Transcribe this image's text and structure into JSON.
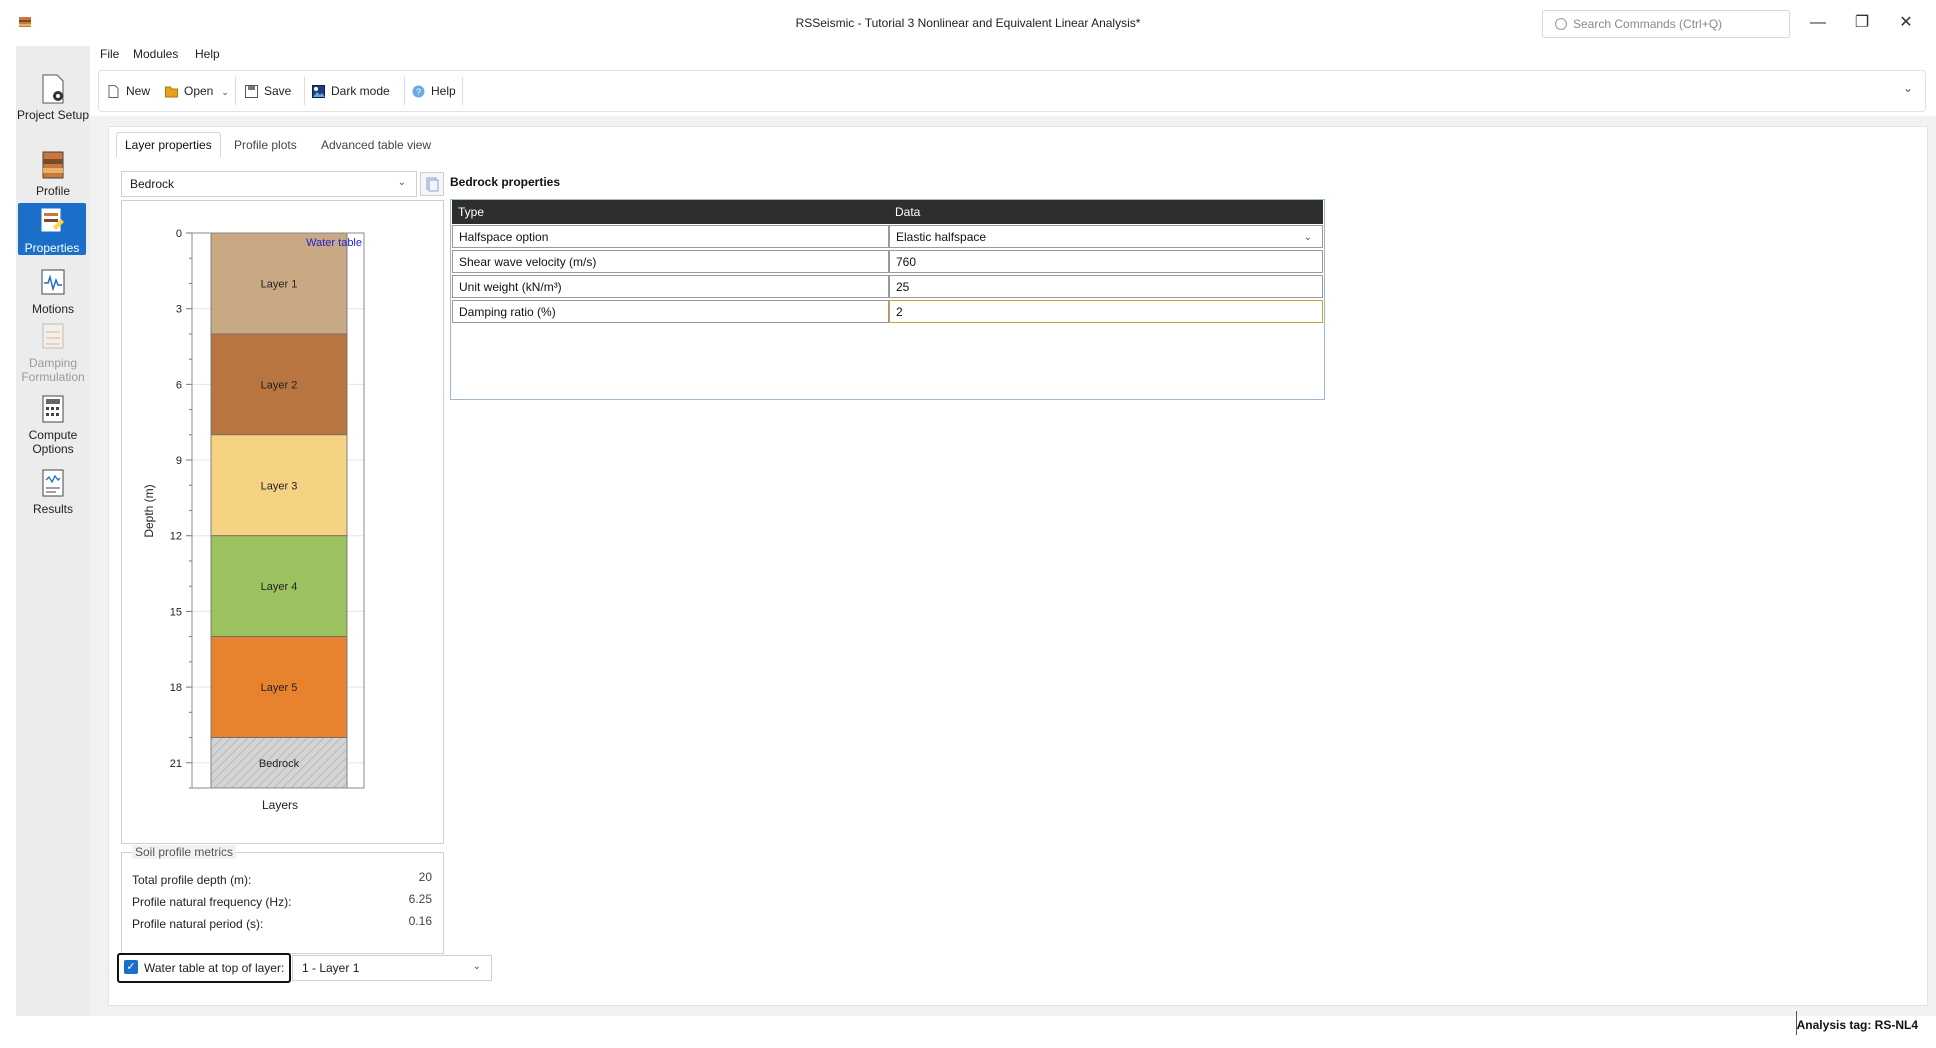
{
  "window": {
    "title": "RSSeismic - Tutorial 3 Nonlinear and Equivalent Linear Analysis*",
    "search_placeholder": "Search Commands (Ctrl+Q)",
    "minimize": "—",
    "restore": "❐",
    "close": "✕"
  },
  "menu": {
    "file": "File",
    "modules": "Modules",
    "help": "Help"
  },
  "toolbar": {
    "new": "New",
    "open": "Open",
    "save": "Save",
    "dark_mode": "Dark mode",
    "help": "Help"
  },
  "sidebar": {
    "items": [
      {
        "label": "Project Setup",
        "icon": "project-setup-icon",
        "state": "normal"
      },
      {
        "label": "Profile",
        "icon": "profile-icon",
        "state": "normal"
      },
      {
        "label": "Properties",
        "icon": "properties-icon",
        "state": "active"
      },
      {
        "label": "Motions",
        "icon": "motions-icon",
        "state": "normal"
      },
      {
        "label": "Damping Formulation",
        "icon": "damping-icon",
        "state": "disabled"
      },
      {
        "label": "Compute Options",
        "icon": "compute-icon",
        "state": "normal"
      },
      {
        "label": "Results",
        "icon": "results-icon",
        "state": "normal"
      }
    ]
  },
  "tabs": [
    {
      "label": "Layer properties",
      "active": true
    },
    {
      "label": "Profile plots",
      "active": false
    },
    {
      "label": "Advanced table view",
      "active": false
    }
  ],
  "layer_select": {
    "value": "Bedrock"
  },
  "profile_plot": {
    "ylabel": "Depth (m)",
    "xlabel": "Layers",
    "water_table_label": "Water table",
    "yticks": [
      "0",
      "3",
      "6",
      "9",
      "12",
      "15",
      "18",
      "21"
    ],
    "layers": [
      {
        "name": "Layer 1",
        "top": 0,
        "bottom": 4,
        "color": "#c9a983"
      },
      {
        "name": "Layer 2",
        "top": 4,
        "bottom": 8,
        "color": "#b87540"
      },
      {
        "name": "Layer 3",
        "top": 8,
        "bottom": 12,
        "color": "#f6d283"
      },
      {
        "name": "Layer 4",
        "top": 12,
        "bottom": 16,
        "color": "#9bc25e"
      },
      {
        "name": "Layer 5",
        "top": 16,
        "bottom": 20,
        "color": "#e8822e"
      },
      {
        "name": "Bedrock",
        "top": 20,
        "bottom": 22,
        "color": "#d4d4d4"
      }
    ],
    "ylim": [
      0,
      22
    ]
  },
  "metrics": {
    "title": "Soil profile metrics",
    "rows": [
      {
        "label": "Total profile depth (m):",
        "value": "20"
      },
      {
        "label": "Profile natural frequency (Hz):",
        "value": "6.25"
      },
      {
        "label": "Profile natural period (s):",
        "value": "0.16"
      }
    ]
  },
  "water_table": {
    "label": "Water table at top of layer:",
    "checked": true,
    "layer_value": "1 - Layer 1"
  },
  "bedrock": {
    "title": "Bedrock properties",
    "col_type": "Type",
    "col_data": "Data",
    "rows": [
      {
        "type": "Halfspace option",
        "data": "Elastic halfspace"
      },
      {
        "type": "Shear wave velocity (m/s)",
        "data": "760"
      },
      {
        "type": "Unit weight (kN/m³)",
        "data": "25"
      },
      {
        "type": "Damping ratio (%)",
        "data": "2"
      }
    ]
  },
  "status": {
    "analysis_tag": "Analysis tag: RS-NL4"
  }
}
